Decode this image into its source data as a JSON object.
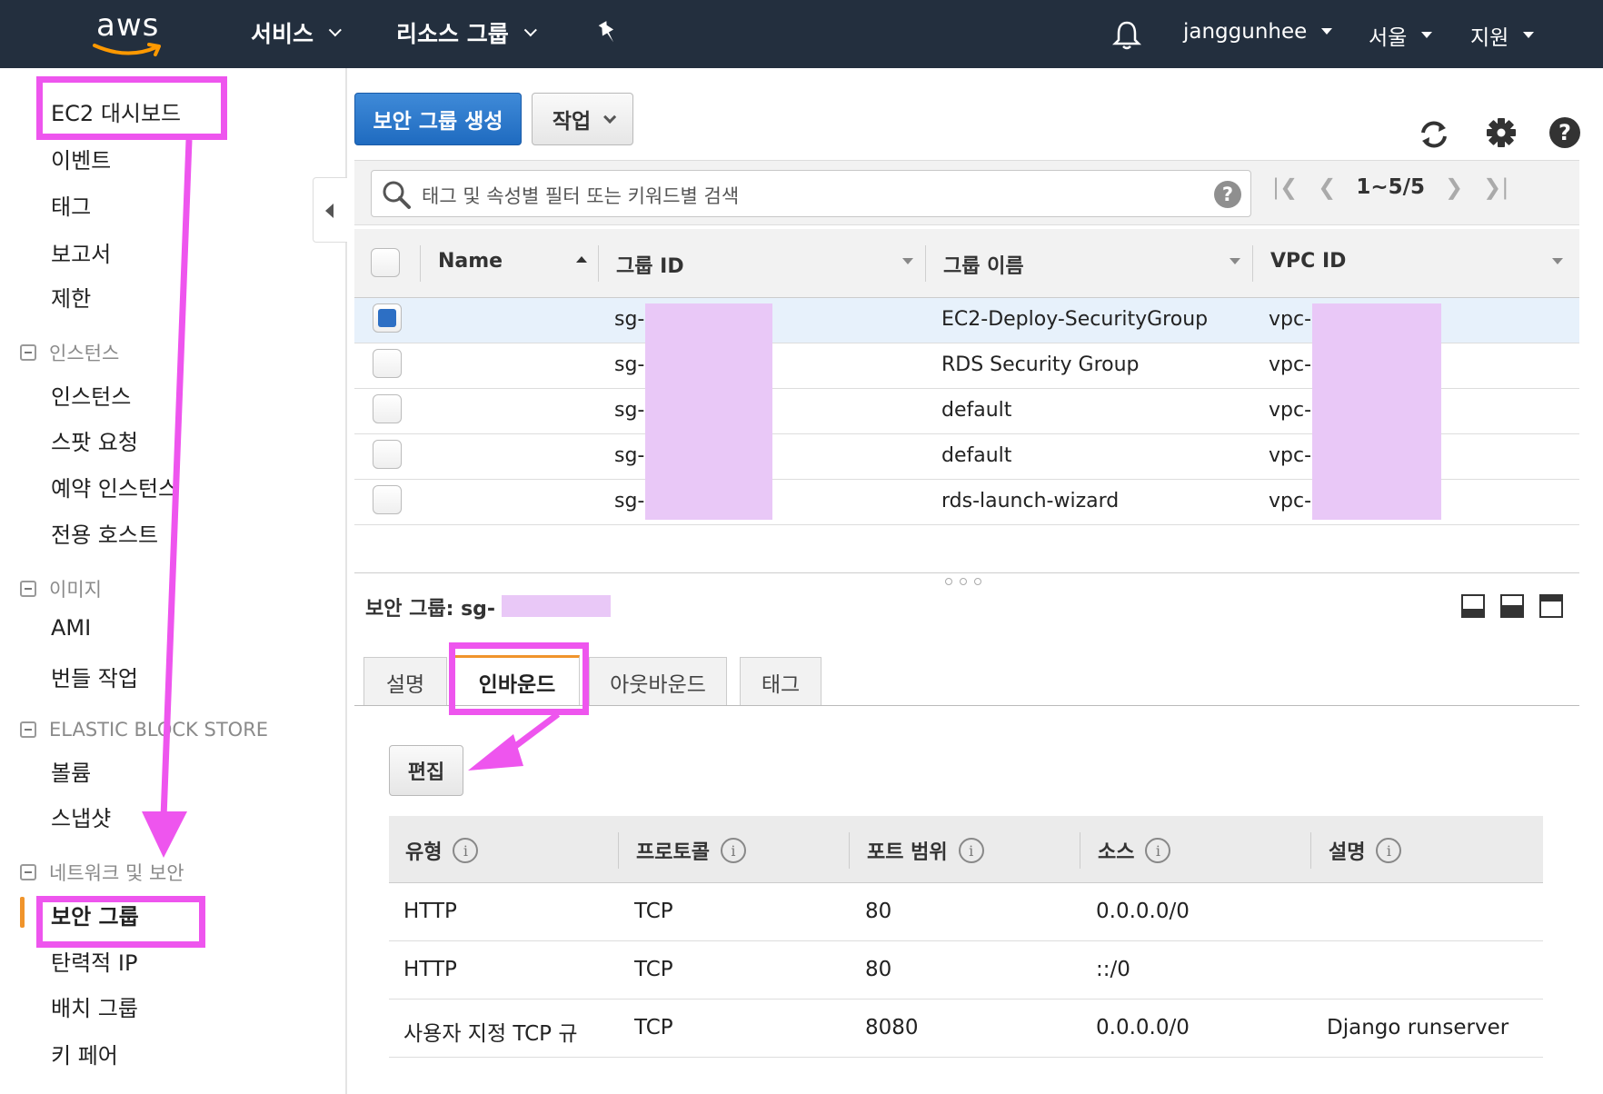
{
  "topnav": {
    "logo_text": "aws",
    "services": "서비스",
    "resource_groups": "리소스 그룹",
    "username": "janggunhee",
    "region": "서울",
    "support": "지원"
  },
  "sidebar": {
    "dashboard": "EC2 대시보드",
    "events": "이벤트",
    "tags": "태그",
    "reports": "보고서",
    "limits": "제한",
    "sections": {
      "instances": "인스턴스",
      "images": "이미지",
      "ebs": "ELASTIC BLOCK STORE",
      "network": "네트워크 및 보안"
    },
    "instances_items": [
      "인스턴스",
      "스팟 요청",
      "예약 인스턴스",
      "전용 호스트"
    ],
    "images_items": [
      "AMI",
      "번들 작업"
    ],
    "ebs_items": [
      "볼륨",
      "스냅샷"
    ],
    "network_items": [
      "보안 그룹",
      "탄력적 IP",
      "배치 그룹",
      "키 페어"
    ]
  },
  "toolbar": {
    "create_label": "보안 그룹 생성",
    "actions_label": "작업"
  },
  "search": {
    "placeholder": "태그 및 속성별 필터 또는 키워드별 검색",
    "help": "?"
  },
  "pager": {
    "range": "1~5/5"
  },
  "table": {
    "columns": [
      "Name",
      "그룹 ID",
      "그룹 이름",
      "VPC ID"
    ],
    "rows": [
      {
        "name": "",
        "group_id": "sg-",
        "group_name": "EC2-Deploy-SecurityGroup",
        "vpc_id": "vpc-",
        "selected": true
      },
      {
        "name": "",
        "group_id": "sg-",
        "group_name": "RDS Security Group",
        "vpc_id": "vpc-",
        "selected": false
      },
      {
        "name": "",
        "group_id": "sg-",
        "group_name": "default",
        "vpc_id": "vpc-",
        "selected": false
      },
      {
        "name": "",
        "group_id": "sg-",
        "group_name": "default",
        "vpc_id": "vpc-",
        "selected": false
      },
      {
        "name": "",
        "group_id": "sg-",
        "group_name": "rds-launch-wizard",
        "vpc_id": "vpc-",
        "selected": false
      }
    ]
  },
  "detail": {
    "title": "보안 그룹: sg-",
    "tabs": [
      "설명",
      "인바운드",
      "아웃바운드",
      "태그"
    ],
    "active_tab": "인바운드",
    "edit_label": "편집",
    "rule_columns": [
      "유형",
      "프로토콜",
      "포트 범위",
      "소스",
      "설명"
    ],
    "rules": [
      {
        "type": "HTTP",
        "protocol": "TCP",
        "port": "80",
        "source": "0.0.0.0/0",
        "desc": ""
      },
      {
        "type": "HTTP",
        "protocol": "TCP",
        "port": "80",
        "source": "::/0",
        "desc": ""
      },
      {
        "type": "사용자 지정 TCP 규",
        "protocol": "TCP",
        "port": "8080",
        "source": "0.0.0.0/0",
        "desc": "Django runserver"
      }
    ]
  },
  "colors": {
    "nav_bg": "#232f3e",
    "primary": "#2a74c8",
    "accent_orange": "#f0942b",
    "annotation": "#ee55ee",
    "redaction": "#e9c8f7"
  }
}
